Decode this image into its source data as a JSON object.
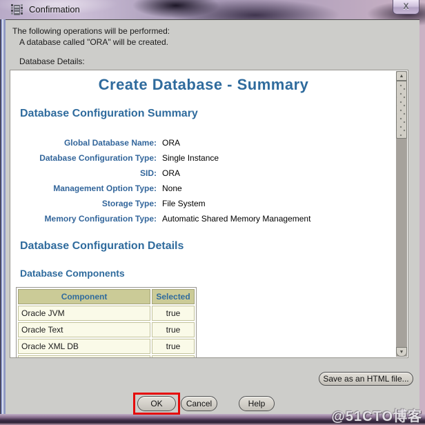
{
  "window": {
    "title": "Confirmation"
  },
  "icons": {
    "close": "X",
    "scroll_up": "▲",
    "scroll_down": "▼"
  },
  "intro": {
    "line1": "The following operations will be performed:",
    "line2": "A database called \"ORA\" will be created.",
    "details_label": "Database Details:"
  },
  "summary_panel": {
    "title": "Create Database - Summary",
    "config_summary_heading": "Database Configuration Summary",
    "fields": [
      {
        "label": "Global Database Name:",
        "value": "ORA"
      },
      {
        "label": "Database Configuration Type:",
        "value": "Single Instance"
      },
      {
        "label": "SID:",
        "value": "ORA"
      },
      {
        "label": "Management Option Type:",
        "value": "None"
      },
      {
        "label": "Storage Type:",
        "value": "File System"
      },
      {
        "label": "Memory Configuration Type:",
        "value": "Automatic Shared Memory Management"
      }
    ],
    "config_details_heading": "Database Configuration Details",
    "components_heading": "Database Components",
    "components_table": {
      "headers": [
        "Component",
        "Selected"
      ],
      "rows": [
        {
          "component": "Oracle JVM",
          "selected": "true"
        },
        {
          "component": "Oracle Text",
          "selected": "true"
        },
        {
          "component": "Oracle XML DB",
          "selected": "true"
        }
      ]
    }
  },
  "buttons": {
    "save_html": "Save as an HTML file...",
    "ok": "OK",
    "cancel": "Cancel",
    "help": "Help"
  },
  "watermark": "@51CTO博客",
  "colors": {
    "heading_blue": "#2f6b9d",
    "label_blue": "#33669b",
    "table_header_bg": "#cbcb97",
    "table_row_bg": "#fafae8",
    "dialog_gray": "#cdcdca",
    "annotation_red": "#e60808"
  }
}
